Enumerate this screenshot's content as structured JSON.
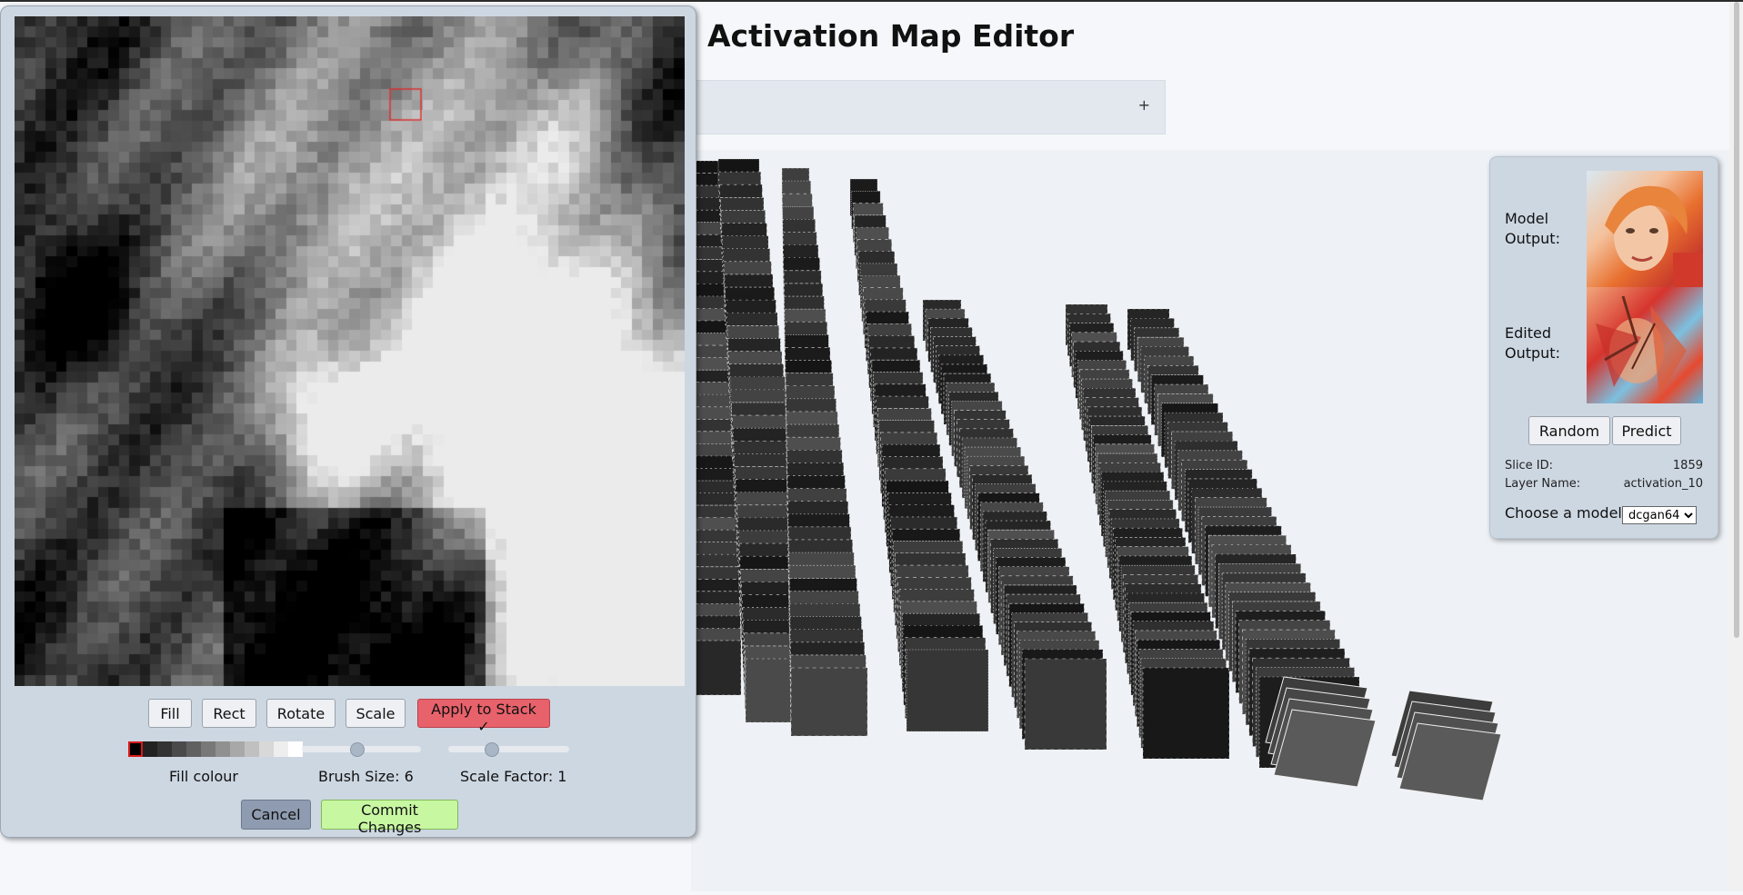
{
  "page": {
    "title": "Activation Map Editor",
    "add_label": "+"
  },
  "editor": {
    "tools": [
      "Fill",
      "Rect",
      "Rotate",
      "Scale"
    ],
    "apply_label": "Apply to Stack ✓",
    "fill_colour_label": "Fill colour",
    "palette": [
      "#000000",
      "#222222",
      "#333333",
      "#4a4a4a",
      "#606060",
      "#787878",
      "#909090",
      "#a8a8a8",
      "#c0c0c0",
      "#d8d8d8",
      "#eeeeee",
      "#ffffff"
    ],
    "selected_swatch": 0,
    "brush_size_label": "Brush Size: 6",
    "brush_size_fraction": 0.46,
    "scale_factor_label": "Scale Factor: 1",
    "scale_factor_fraction": 0.34,
    "cancel_label": "Cancel",
    "commit_label": "Commit Changes"
  },
  "info": {
    "model_output_label": "Model Output:",
    "edited_output_label": "Edited Output:",
    "random_label": "Random",
    "predict_label": "Predict",
    "slice_id_label": "Slice ID:",
    "slice_id_value": "1859",
    "layer_name_label": "Layer Name:",
    "layer_name_value": "activation_10",
    "choose_model_label": "Choose a model:",
    "model_selected": "dcgan64"
  },
  "colors": {
    "panel_bg": "#cdd7e2",
    "apply_button": "#e8626b",
    "commit_button": "#c8f7a2",
    "cancel_button": "#8e9bb0"
  },
  "icons": {
    "add": "plus-icon",
    "model_dropdown": "chevron-down-icon"
  }
}
